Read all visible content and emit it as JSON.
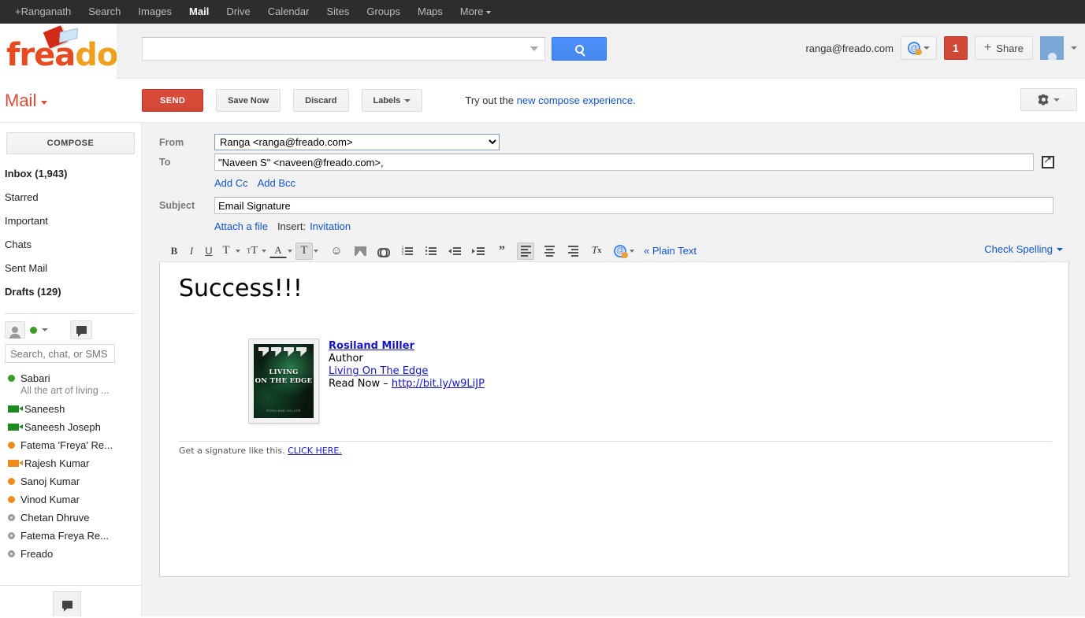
{
  "gbar": {
    "items": [
      {
        "label": "+Ranganath",
        "active": false,
        "caret": false
      },
      {
        "label": "Search",
        "active": false,
        "caret": false
      },
      {
        "label": "Images",
        "active": false,
        "caret": false
      },
      {
        "label": "Mail",
        "active": true,
        "caret": false
      },
      {
        "label": "Drive",
        "active": false,
        "caret": false
      },
      {
        "label": "Calendar",
        "active": false,
        "caret": false
      },
      {
        "label": "Sites",
        "active": false,
        "caret": false
      },
      {
        "label": "Groups",
        "active": false,
        "caret": false
      },
      {
        "label": "Maps",
        "active": false,
        "caret": false
      },
      {
        "label": "More",
        "active": false,
        "caret": true
      }
    ]
  },
  "brand": {
    "logo_part1": "frea",
    "logo_part2": "do"
  },
  "search": {
    "value": "",
    "placeholder": ""
  },
  "header": {
    "account_email": "ranga@freado.com",
    "notification_count": "1",
    "share_label": "Share",
    "share_plus": "+"
  },
  "compose_toolbar": {
    "mail_label": "Mail",
    "send_label": "SEND",
    "save_label": "Save Now",
    "discard_label": "Discard",
    "labels_label": "Labels",
    "try_prefix": "Try out the ",
    "try_link": "new compose experience.",
    "gear_label": ""
  },
  "sidebar": {
    "compose_label": "COMPOSE",
    "nav": [
      {
        "label": "Inbox (1,943)",
        "bold": true
      },
      {
        "label": "Starred",
        "bold": false
      },
      {
        "label": "Important",
        "bold": false
      },
      {
        "label": "Chats",
        "bold": false
      },
      {
        "label": "Sent Mail",
        "bold": false
      },
      {
        "label": "Drafts (129)",
        "bold": true
      }
    ],
    "chat_search_placeholder": "Search, chat, or SMS",
    "chat_search_value": "",
    "buddies": [
      {
        "name": "Sabari",
        "status": "available",
        "icon": "dot-green",
        "sub": "All the art of living ..."
      },
      {
        "name": "Saneesh",
        "status": "video",
        "icon": "video-green",
        "sub": ""
      },
      {
        "name": "Saneesh Joseph",
        "status": "video",
        "icon": "video-green",
        "sub": ""
      },
      {
        "name": "Fatema 'Freya' Re...",
        "status": "idle",
        "icon": "dot-orange",
        "sub": ""
      },
      {
        "name": "Rajesh Kumar",
        "status": "video-idle",
        "icon": "video-orange",
        "sub": ""
      },
      {
        "name": "Sanoj Kumar",
        "status": "idle",
        "icon": "dot-orange",
        "sub": ""
      },
      {
        "name": "Vinod Kumar",
        "status": "idle",
        "icon": "dot-orange",
        "sub": ""
      },
      {
        "name": "Chetan Dhruve",
        "status": "offline",
        "icon": "dot-gray",
        "sub": ""
      },
      {
        "name": "Fatema Freya Re...",
        "status": "offline",
        "icon": "dot-gray",
        "sub": ""
      },
      {
        "name": "Freado",
        "status": "offline",
        "icon": "dot-gray",
        "sub": ""
      }
    ]
  },
  "compose": {
    "from_label": "From",
    "from_value": "Ranga <ranga@freado.com>",
    "to_label": "To",
    "to_value": "\"Naveen S\" <naveen@freado.com>,",
    "add_cc": "Add Cc",
    "add_bcc": "Add Bcc",
    "subject_label": "Subject",
    "subject_value": "Email Signature",
    "attach_label": "Attach a file",
    "insert_label": "Insert:",
    "invitation_label": "Invitation"
  },
  "format_toolbar": {
    "bold": "B",
    "italic": "I",
    "underline": "U",
    "font_family": "T",
    "font_size": "ᴛT",
    "text_color": "A",
    "highlight": "T",
    "plain_text_label": "« Plain Text",
    "check_spelling_label": "Check Spelling"
  },
  "email_body": {
    "heading": "Success!!!",
    "signature": {
      "name": "Rosiland Miller",
      "role": "Author",
      "book_title_link": "Living On The Edge",
      "read_now_prefix": "Read Now – ",
      "read_now_url": "http://bit.ly/w9LiJP",
      "book_cover_title_line1": "LIVING",
      "book_cover_title_line2": "ON THE EDGE",
      "book_cover_author": "ROSILAND MILLER"
    },
    "footer_text": "Get a signature like this.",
    "footer_link": "CLICK HERE."
  },
  "colors": {
    "brand_orange": "#e8491f",
    "brand_amber": "#f0a020",
    "send_red": "#d14836",
    "link_blue": "#1155cc",
    "search_blue": "#4387fd",
    "gbar_dark": "#2d2d2d"
  }
}
